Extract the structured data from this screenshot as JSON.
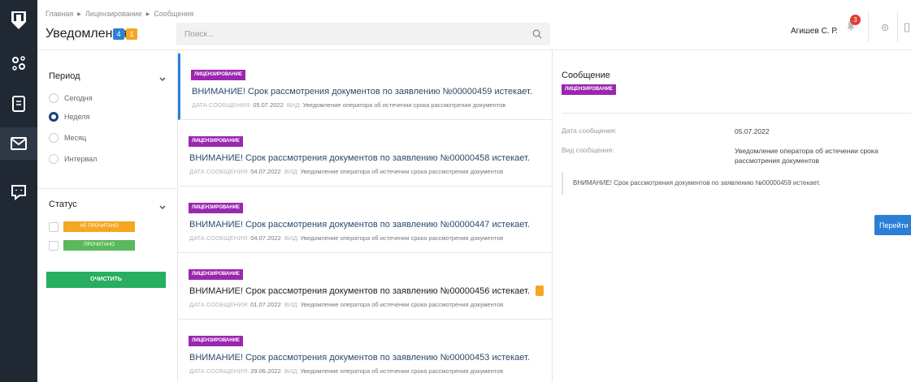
{
  "header": {
    "breadcrumb": [
      "Главная",
      "Лицензирование",
      "Сообщения"
    ],
    "title": "Уведомления",
    "badge_blue": "4",
    "badge_orange": "1",
    "search_placeholder": "Поиск...",
    "user_name": "Агишев С. Р.",
    "notification_count": "3"
  },
  "rail": {
    "icons": [
      "logo-shield-icon",
      "settings-icon",
      "document-icon",
      "mail-icon",
      "chat-icon"
    ],
    "active": "mail-icon"
  },
  "filters": {
    "period_title": "Период",
    "period_options": [
      {
        "label": "Сегодня",
        "selected": false
      },
      {
        "label": "Неделя",
        "selected": true
      },
      {
        "label": "Месяц",
        "selected": false
      },
      {
        "label": "Интервал",
        "selected": false
      }
    ],
    "status_title": "Статус",
    "status_options": [
      "НЕ ПРОЧИТАНО",
      "ПРОЧИТАНО"
    ],
    "clear_label": "ОЧИСТИТЬ"
  },
  "list": {
    "date_key": "ДАТА СООБЩЕНИЯ:",
    "type_key": "ВИД:",
    "items": [
      {
        "tag": "ЛИЦЕНЗИРОВАНИЕ",
        "title": "ВНИМАНИЕ! Срок рассмотрения документов по заявлению №00000459 истекает.",
        "date": "05.07.2022",
        "type": "Уведомление оператора об истечении срока рассмотрения документов",
        "active": true,
        "unread": false
      },
      {
        "tag": "ЛИЦЕНЗИРОВАНИЕ",
        "title": "ВНИМАНИЕ! Срок рассмотрения документов по заявлению №00000458 истекает.",
        "date": "04.07.2022",
        "type": "Уведомление оператора об истечении срока рассмотрения документов",
        "active": false,
        "unread": false
      },
      {
        "tag": "ЛИЦЕНЗИРОВАНИЕ",
        "title": "ВНИМАНИЕ! Срок рассмотрения документов по заявлению №00000447 истекает.",
        "date": "04.07.2022",
        "type": "Уведомление оператора об истечении срока рассмотрения документов",
        "active": false,
        "unread": false
      },
      {
        "tag": "ЛИЦЕНЗИРОВАНИЕ",
        "title": "ВНИМАНИЕ! Срок рассмотрения документов по заявлению №00000456 истекает.",
        "date": "01.07.2022",
        "type": "Уведомление оператора об истечении срока рассмотрения документов",
        "active": false,
        "unread": true
      },
      {
        "tag": "ЛИЦЕНЗИРОВАНИЕ",
        "title": "ВНИМАНИЕ! Срок рассмотрения документов по заявлению №00000453 истекает.",
        "date": "29.06.2022",
        "type": "Уведомление оператора об истечении срока рассмотрения документов",
        "active": false,
        "unread": false
      }
    ]
  },
  "detail": {
    "title": "Сообщение",
    "tag": "ЛИЦЕНЗИРОВАНИЕ",
    "date_label": "Дата сообщения:",
    "date_value": "05.07.2022",
    "type_label": "Вид сообщения:",
    "type_value": "Уведомление оператора об истечении срока рассмотрения документов",
    "body": "ВНИМАНИЕ! Срок рассмотрения документов по заявлению №00000459 истекает.",
    "go_label": "Перейти"
  },
  "colors": {
    "rail": "#1f2833",
    "accent_blue": "#2b7fd6",
    "tag_purple": "#9b27b0",
    "unread_orange": "#f5a623",
    "read_green": "#5cb85c",
    "clear_green": "#27ae60"
  }
}
